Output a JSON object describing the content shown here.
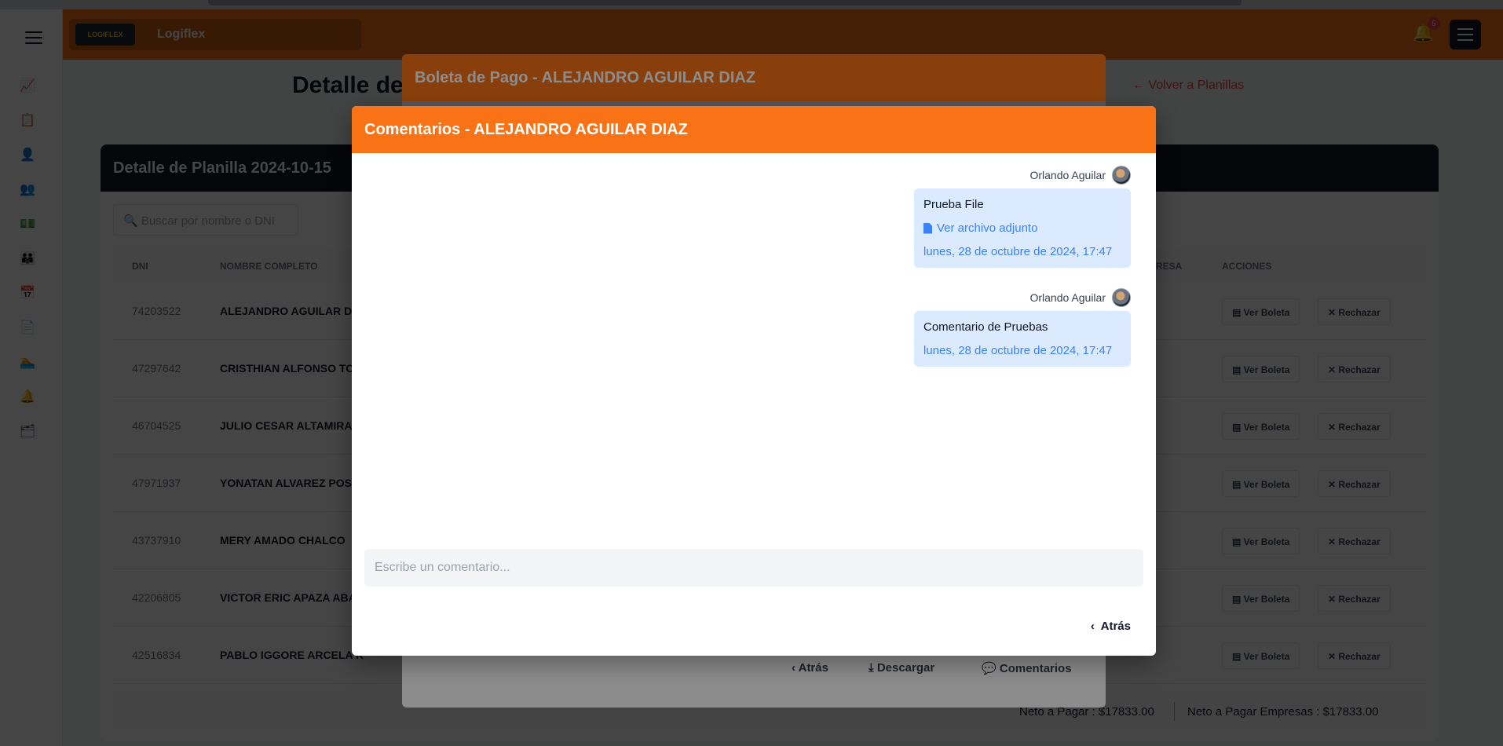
{
  "header": {
    "logo_mark": "LOGIFLEX",
    "app_name": "Logiflex",
    "notification_count": "5"
  },
  "page": {
    "title": "Detalle de",
    "back_link": "Volver a Planillas"
  },
  "card": {
    "title": "Detalle de Planilla 2024-10-15",
    "search_placeholder": "Buscar por nombre o DNI",
    "columns": {
      "dni": "DNI",
      "name": "NOMBRE COMPLETO",
      "empresa": "RESA",
      "actions": "ACCIONES"
    },
    "rows": [
      {
        "dni": "74203522",
        "name": "ALEJANDRO AGUILAR DIAZ"
      },
      {
        "dni": "47297642",
        "name": "CRISTHIAN ALFONSO TOR"
      },
      {
        "dni": "46704525",
        "name": "JULIO CESAR ALTAMIRANO"
      },
      {
        "dni": "47971937",
        "name": "YONATAN ALVAREZ POST"
      },
      {
        "dni": "43737910",
        "name": "MERY AMADO CHALCO"
      },
      {
        "dni": "42206805",
        "name": "VICTOR ERIC APAZA ABAR"
      },
      {
        "dni": "42516834",
        "name": "PABLO IGGORE ARCELA R"
      }
    ],
    "row_buttons": {
      "ver": "Ver Boleta",
      "rechazar": "Rechazar"
    },
    "totals": {
      "neto": "Neto a Pagar : $17833.00",
      "neto_empresas": "Neto a Pagar Empresas : $17833.00"
    }
  },
  "boleta_modal": {
    "title": "Boleta de Pago - ALEJANDRO AGUILAR DIAZ",
    "footer": {
      "atras": "Atrás",
      "descargar": "Descargar",
      "comentarios": "Comentarios"
    }
  },
  "comments_modal": {
    "title": "Comentarios - ALEJANDRO AGUILAR DIAZ",
    "messages": [
      {
        "author": "Orlando Aguilar",
        "text": "Prueba File",
        "attachment": "Ver archivo adjunto",
        "date": "lunes, 28 de octubre de 2024, 17:47"
      },
      {
        "author": "Orlando Aguilar",
        "text": "Comentario de Pruebas",
        "date": "lunes, 28 de octubre de 2024, 17:47"
      }
    ],
    "input_placeholder": "Escribe un comentario...",
    "back_button": "Atrás"
  },
  "colors": {
    "accent": "#f97316",
    "link": "#3b82f6",
    "bubble": "#dbeafe"
  }
}
